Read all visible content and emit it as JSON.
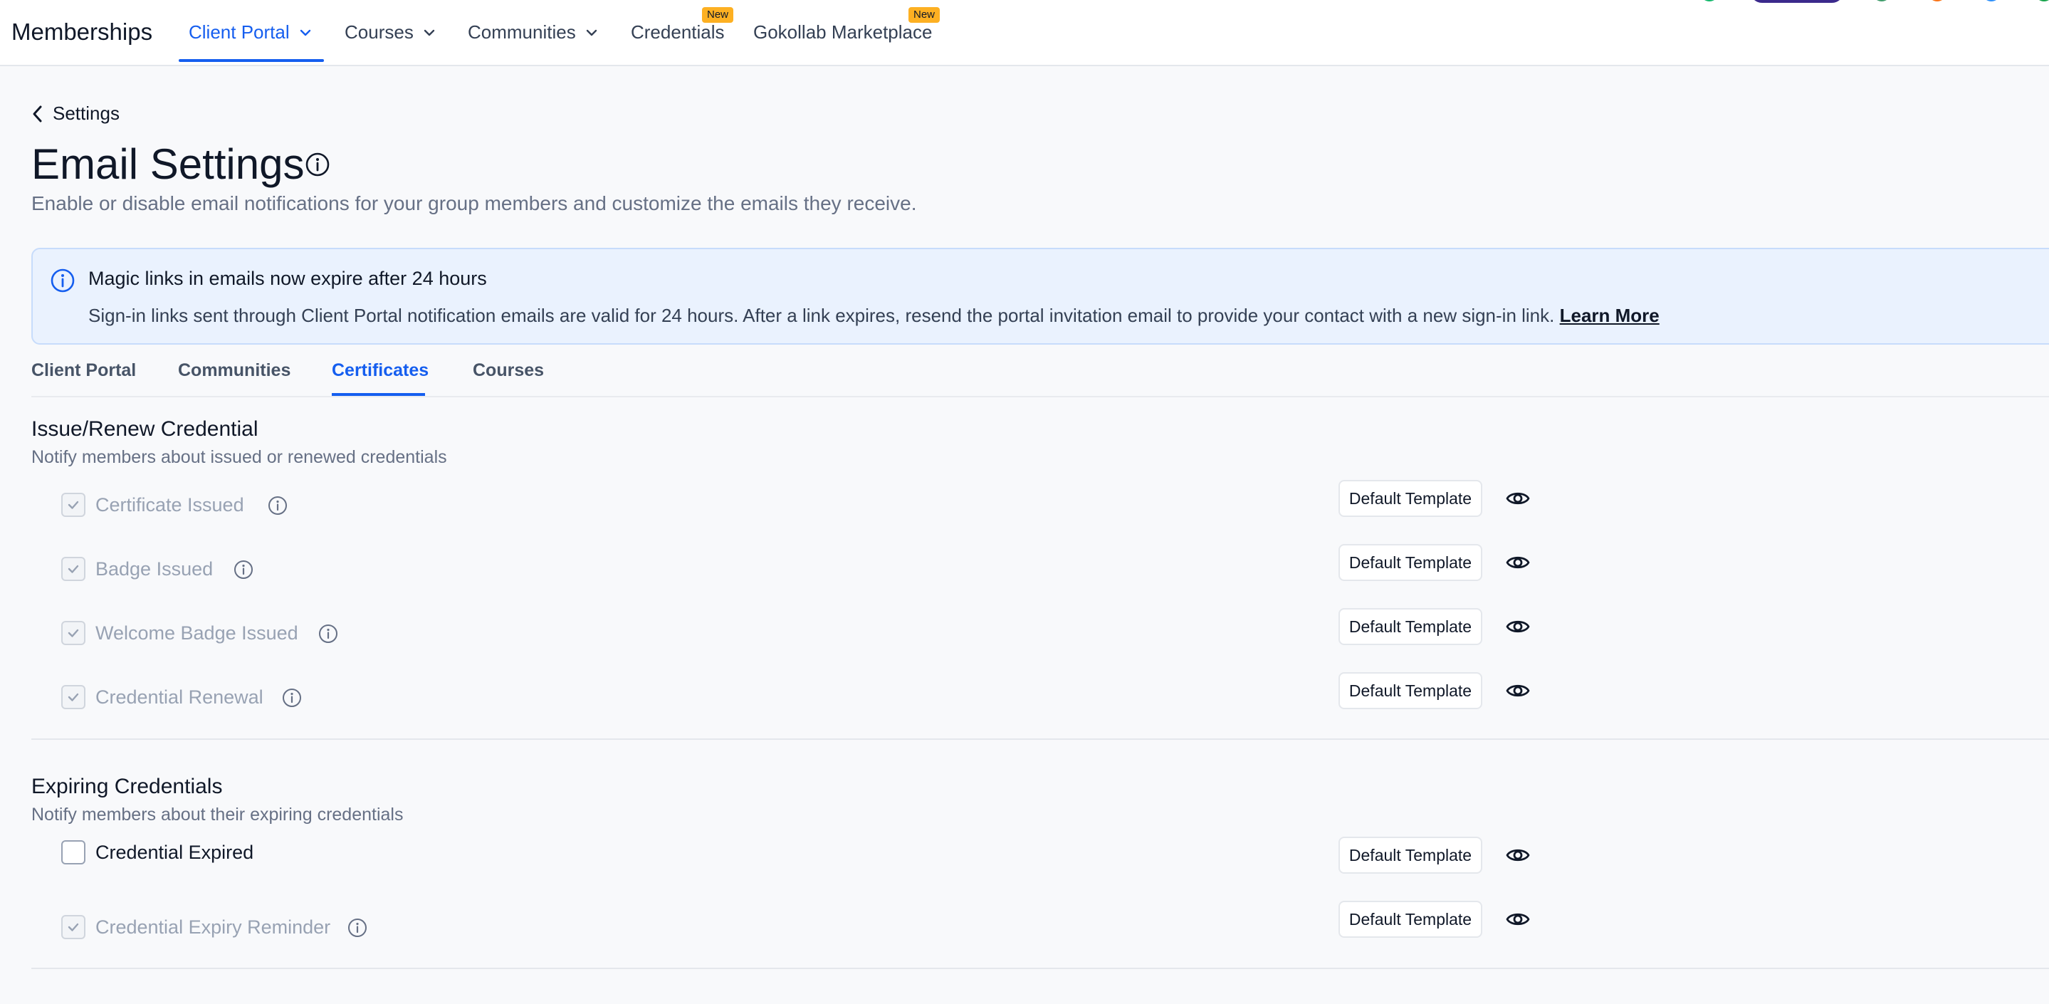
{
  "nav": {
    "brand": "Memberships",
    "items": [
      {
        "label": "Client Portal"
      },
      {
        "label": "Courses"
      },
      {
        "label": "Communities"
      },
      {
        "label": "Credentials",
        "badge": "New"
      },
      {
        "label": "Gokollab Marketplace",
        "badge": "New"
      }
    ]
  },
  "header": {
    "back_label": "Settings",
    "title": "Email Settings",
    "subtitle": "Enable or disable email notifications for your group members and customize the emails they receive."
  },
  "banner": {
    "title": "Magic links in emails now expire after 24 hours",
    "text": "Sign-in links sent through Client Portal notification emails are valid for 24 hours. After a link expires, resend the portal invitation email to provide your contact with a new sign-in link.",
    "link": "Learn More"
  },
  "tabs": [
    {
      "label": "Client Portal"
    },
    {
      "label": "Communities"
    },
    {
      "label": "Certificates",
      "active": true
    },
    {
      "label": "Courses"
    }
  ],
  "sections": [
    {
      "title": "Issue/Renew Credential",
      "subtitle": "Notify members about issued or renewed credentials",
      "rows": [
        {
          "label": "Certificate Issued",
          "checked": true,
          "disabled": true
        },
        {
          "label": "Badge Issued",
          "checked": true,
          "disabled": true
        },
        {
          "label": "Welcome Badge Issued",
          "checked": true,
          "disabled": true
        },
        {
          "label": "Credential Renewal",
          "checked": true,
          "disabled": true
        }
      ]
    },
    {
      "title": "Expiring Credentials",
      "subtitle": "Notify members about their expiring credentials",
      "rows": [
        {
          "label": "Credential Expired",
          "checked": false,
          "disabled": false
        },
        {
          "label": "Credential Expiry Reminder",
          "checked": true,
          "disabled": true
        }
      ]
    }
  ],
  "template_button_label": "Default Template",
  "colors": {
    "accent": "#155eef",
    "badge": "#fdb022"
  }
}
